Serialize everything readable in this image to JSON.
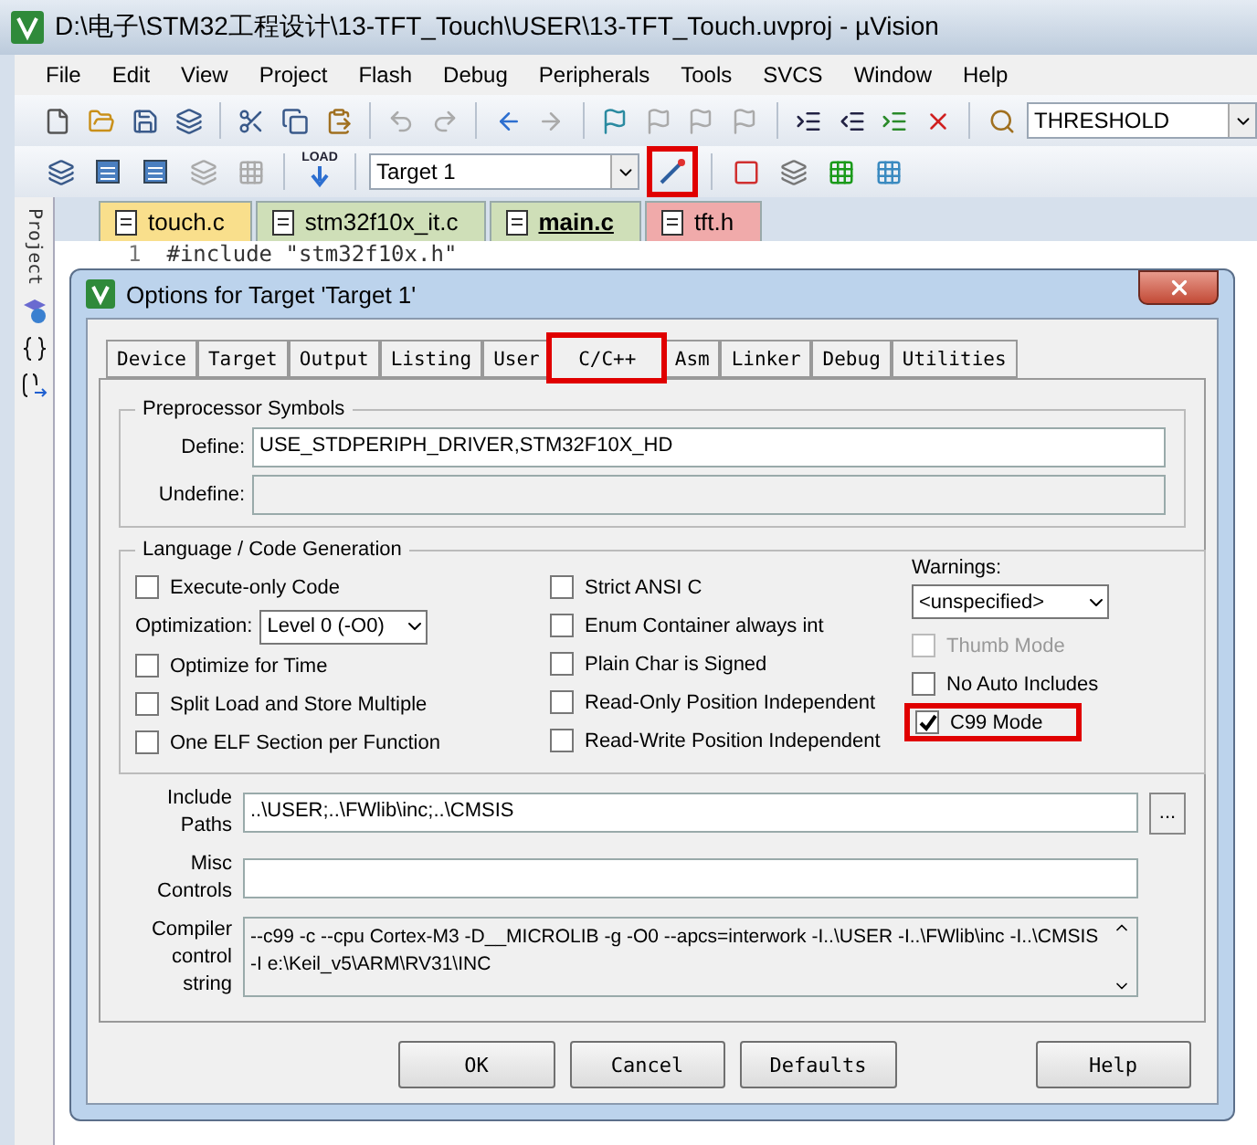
{
  "window": {
    "title": "D:\\电子\\STM32工程设计\\13-TFT_Touch\\USER\\13-TFT_Touch.uvproj - µVision"
  },
  "menu": [
    "File",
    "Edit",
    "View",
    "Project",
    "Flash",
    "Debug",
    "Peripherals",
    "Tools",
    "SVCS",
    "Window",
    "Help"
  ],
  "toolbar": {
    "find_value": "THRESHOLD"
  },
  "build_toolbar": {
    "load_label": "LOAD",
    "target": "Target 1",
    "options_highlighted": true
  },
  "sidebar": {
    "label": "Project"
  },
  "editor_tabs": [
    {
      "label": "touch.c",
      "selected": false,
      "color": "#f9df8c"
    },
    {
      "label": "stm32f10x_it.c",
      "selected": false,
      "color": "#cfdfb8"
    },
    {
      "label": "main.c",
      "selected": true,
      "color": "#cfdfb8"
    },
    {
      "label": "tft.h",
      "selected": false,
      "color": "#f0aaaa"
    }
  ],
  "editor": {
    "lines": [
      {
        "number": "1",
        "code": "#include \"stm32f10x.h\""
      }
    ]
  },
  "dialog": {
    "title": "Options for Target 'Target 1'",
    "tabs": [
      {
        "label": "Device",
        "selected": false,
        "highlighted": false
      },
      {
        "label": "Target",
        "selected": false,
        "highlighted": false
      },
      {
        "label": "Output",
        "selected": false,
        "highlighted": false
      },
      {
        "label": "Listing",
        "selected": false,
        "highlighted": false
      },
      {
        "label": "User",
        "selected": false,
        "highlighted": false
      },
      {
        "label": "C/C++",
        "selected": true,
        "highlighted": true
      },
      {
        "label": "Asm",
        "selected": false,
        "highlighted": false
      },
      {
        "label": "Linker",
        "selected": false,
        "highlighted": false
      },
      {
        "label": "Debug",
        "selected": false,
        "highlighted": false
      },
      {
        "label": "Utilities",
        "selected": false,
        "highlighted": false
      }
    ],
    "preprocessor": {
      "title": "Preprocessor Symbols",
      "fields": [
        {
          "label": "Define:",
          "value": "USE_STDPERIPH_DRIVER,STM32F10X_HD",
          "disabled": false
        },
        {
          "label": "Undefine:",
          "disabled": true
        }
      ]
    },
    "language": {
      "title": "Language / Code Generation",
      "columns": [
        [
          {
            "kind": "checkbox",
            "label": "Execute-only Code",
            "checked": false,
            "disabled": false,
            "highlighted": false
          },
          {
            "kind": "select",
            "label": "Optimization:",
            "value": "Level 0 (-O0)"
          },
          {
            "kind": "checkbox",
            "label": "Optimize for Time",
            "checked": false,
            "disabled": false,
            "highlighted": false
          },
          {
            "kind": "checkbox",
            "label": "Split Load and Store Multiple",
            "checked": false,
            "disabled": false,
            "highlighted": false
          },
          {
            "kind": "checkbox",
            "label": "One ELF Section per Function",
            "checked": false,
            "disabled": false,
            "highlighted": false
          }
        ],
        [
          {
            "kind": "checkbox",
            "label": "Strict ANSI C",
            "checked": false,
            "disabled": false,
            "highlighted": false
          },
          {
            "kind": "checkbox",
            "label": "Enum Container always int",
            "checked": false,
            "disabled": false,
            "highlighted": false
          },
          {
            "kind": "checkbox",
            "label": "Plain Char is Signed",
            "checked": false,
            "disabled": false,
            "highlighted": false
          },
          {
            "kind": "checkbox",
            "label": "Read-Only Position Independent",
            "checked": false,
            "disabled": false,
            "highlighted": false
          },
          {
            "kind": "checkbox",
            "label": "Read-Write Position Independent",
            "checked": false,
            "disabled": false,
            "highlighted": false
          }
        ],
        [
          {
            "kind": "stacked_select",
            "label": "Warnings:",
            "value": "<unspecified>"
          },
          {
            "kind": "checkbox",
            "label": "Thumb Mode",
            "checked": false,
            "disabled": true,
            "highlighted": false
          },
          {
            "kind": "checkbox",
            "label": "No Auto Includes",
            "checked": false,
            "disabled": false,
            "highlighted": false
          },
          {
            "kind": "checkbox",
            "label": "C99 Mode",
            "checked": true,
            "disabled": false,
            "highlighted": true
          }
        ]
      ]
    },
    "include_paths": {
      "label": "Include Paths",
      "value": "..\\USER;..\\FWlib\\inc;..\\CMSIS",
      "browse": "..."
    },
    "misc_controls": {
      "label": "Misc Controls"
    },
    "compiler_string": {
      "label": "Compiler control string",
      "value": "--c99 -c --cpu Cortex-M3 -D__MICROLIB -g -O0 --apcs=interwork -I..\\USER -I..\\FWlib\\inc -I..\\CMSIS -I e:\\Keil_v5\\ARM\\RV31\\INC"
    },
    "buttons": [
      "OK",
      "Cancel",
      "Defaults",
      "Help"
    ]
  }
}
